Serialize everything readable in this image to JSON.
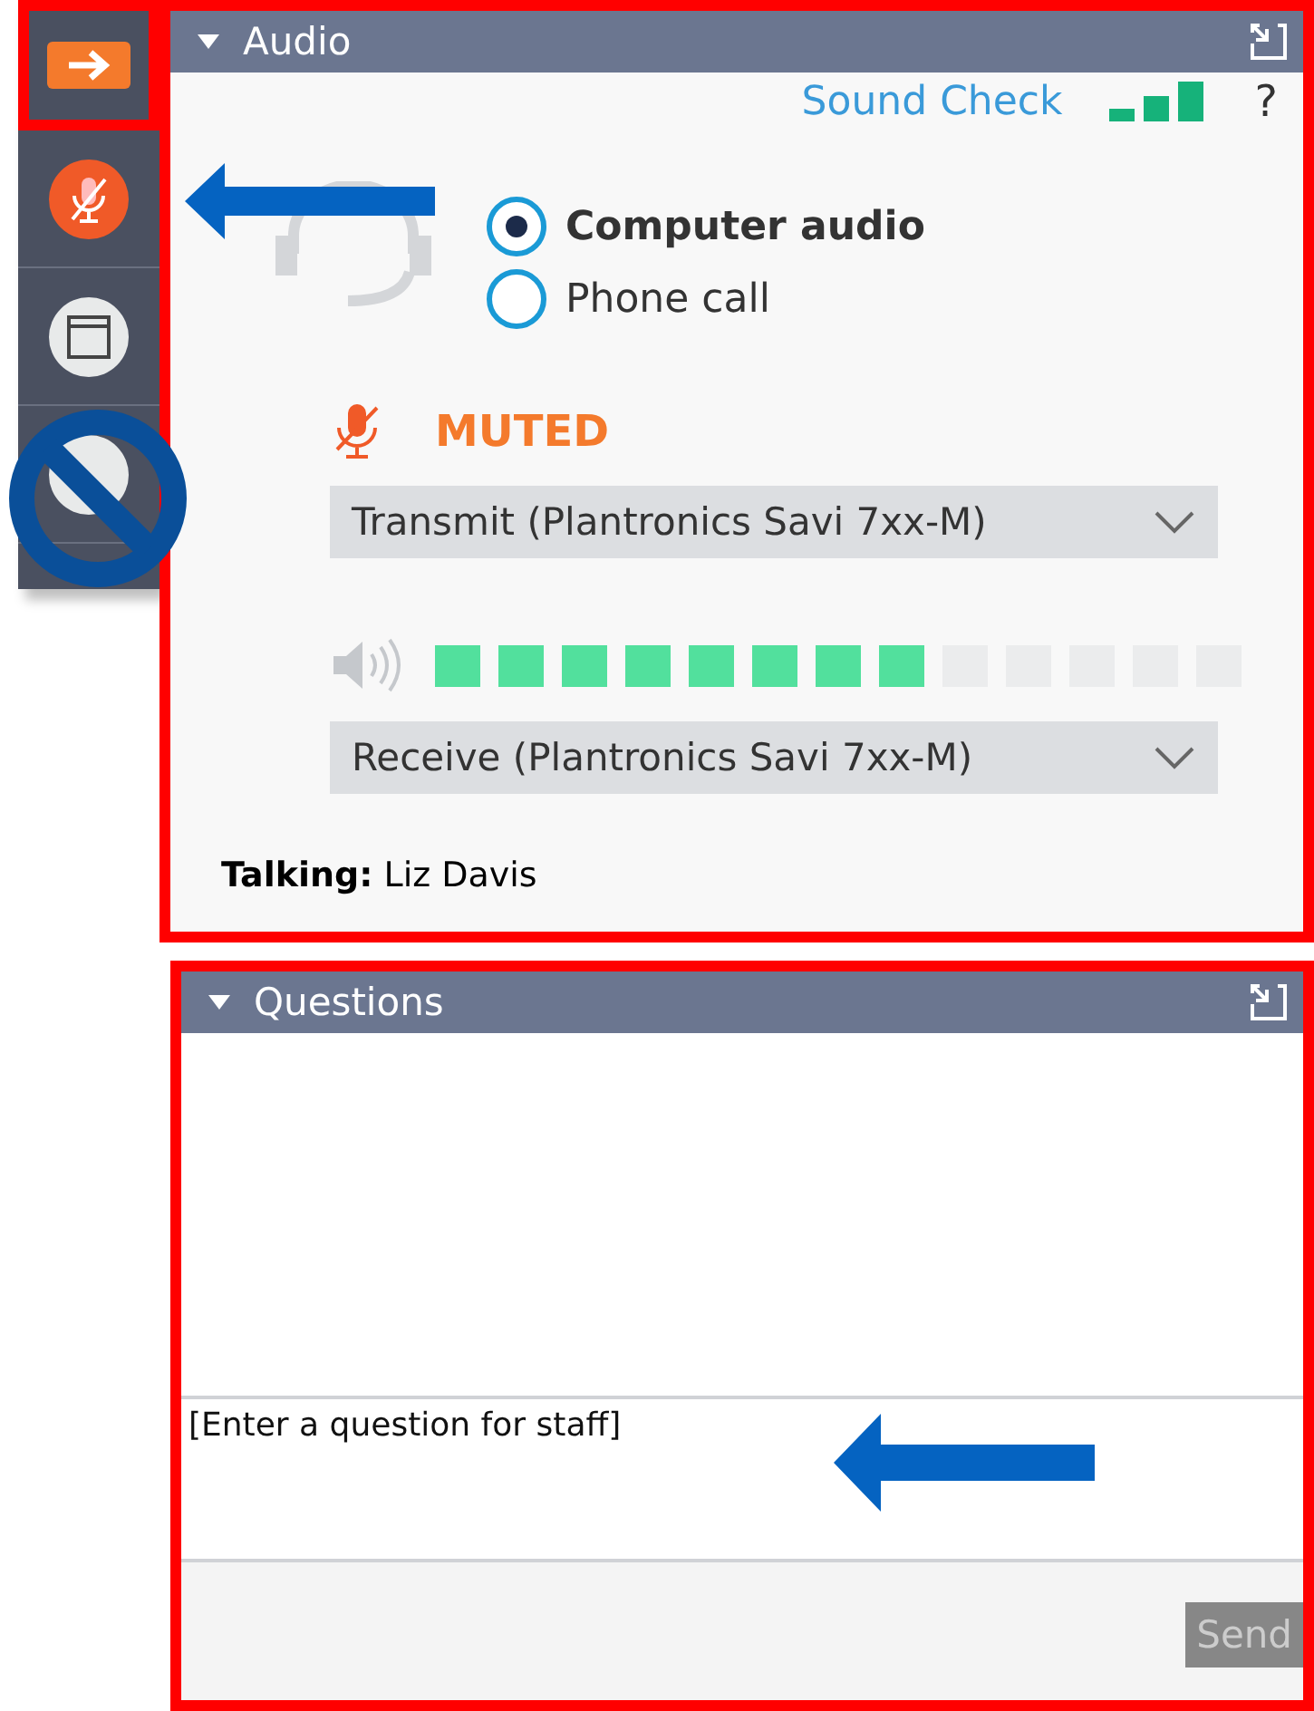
{
  "sidebar": {
    "buttons": [
      {
        "kind": "arrow",
        "highlighted": true
      },
      {
        "kind": "mic-muted",
        "highlighted": false
      },
      {
        "kind": "window",
        "highlighted": false
      },
      {
        "kind": "blocked",
        "highlighted": false
      }
    ]
  },
  "audio": {
    "title": "Audio",
    "sound_check": "Sound Check",
    "help": "?",
    "options": [
      {
        "label": "Computer audio",
        "selected": true
      },
      {
        "label": "Phone call",
        "selected": false
      }
    ],
    "muted_label": "MUTED",
    "transmit": "Transmit (Plantronics Savi 7xx-M)",
    "volume": {
      "level": 0.615
    },
    "receive": "Receive (Plantronics Savi 7xx-M)",
    "talking": "**Talking:** Liz Davis"
  },
  "questions": {
    "title": "Questions",
    "placeholder": "[Enter a question for staff]",
    "send": {
      "label": "Send",
      "disabled": true
    }
  }
}
